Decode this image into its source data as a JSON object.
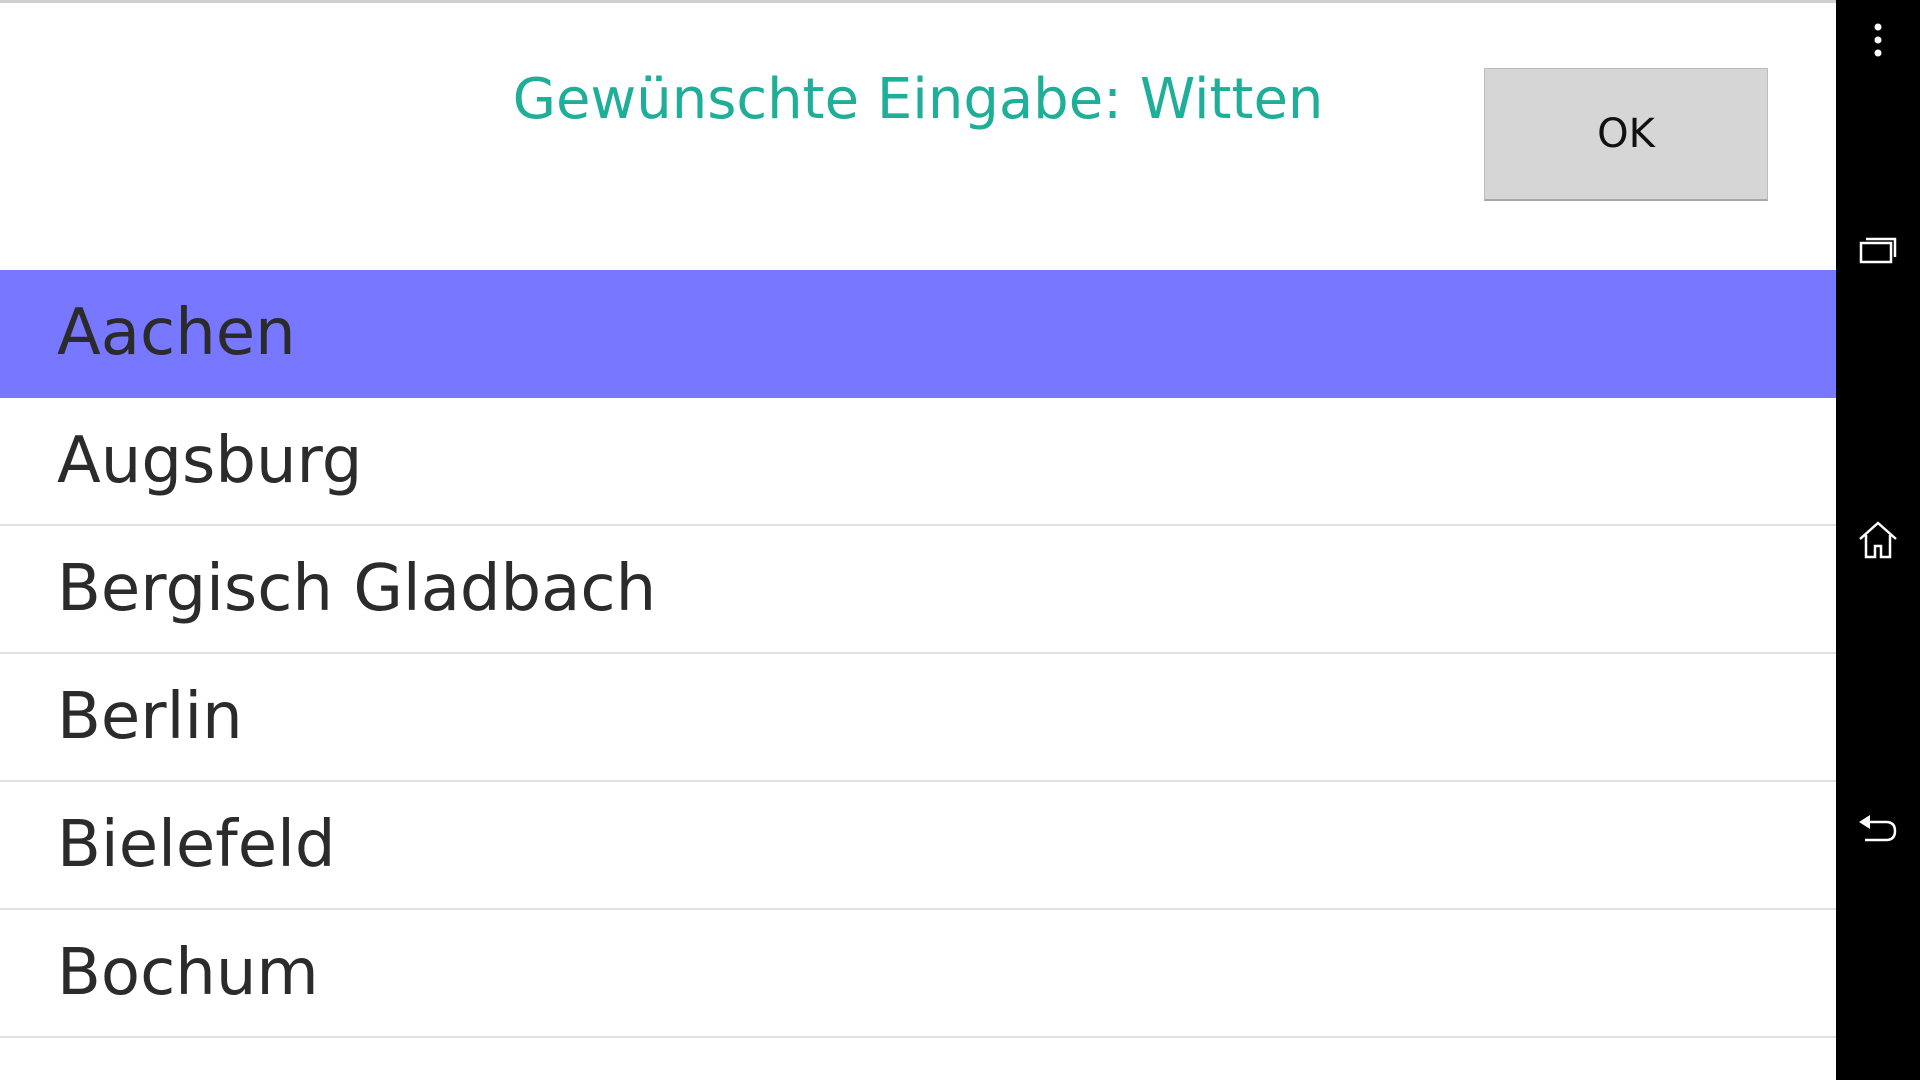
{
  "header": {
    "prompt": "Gewünschte Eingabe: Witten",
    "ok_label": "OK"
  },
  "cities": [
    {
      "name": "Aachen",
      "selected": true
    },
    {
      "name": "Augsburg",
      "selected": false
    },
    {
      "name": "Bergisch Gladbach",
      "selected": false
    },
    {
      "name": "Berlin",
      "selected": false
    },
    {
      "name": "Bielefeld",
      "selected": false
    },
    {
      "name": "Bochum",
      "selected": false
    }
  ],
  "navbar": {
    "buttons": [
      "overflow-menu-icon",
      "recent-apps-icon",
      "home-icon",
      "back-icon"
    ]
  },
  "colors": {
    "prompt": "#1fae98",
    "selected_row": "#7777ff",
    "button_bg": "#d6d6d6",
    "navbar_bg": "#000000"
  }
}
